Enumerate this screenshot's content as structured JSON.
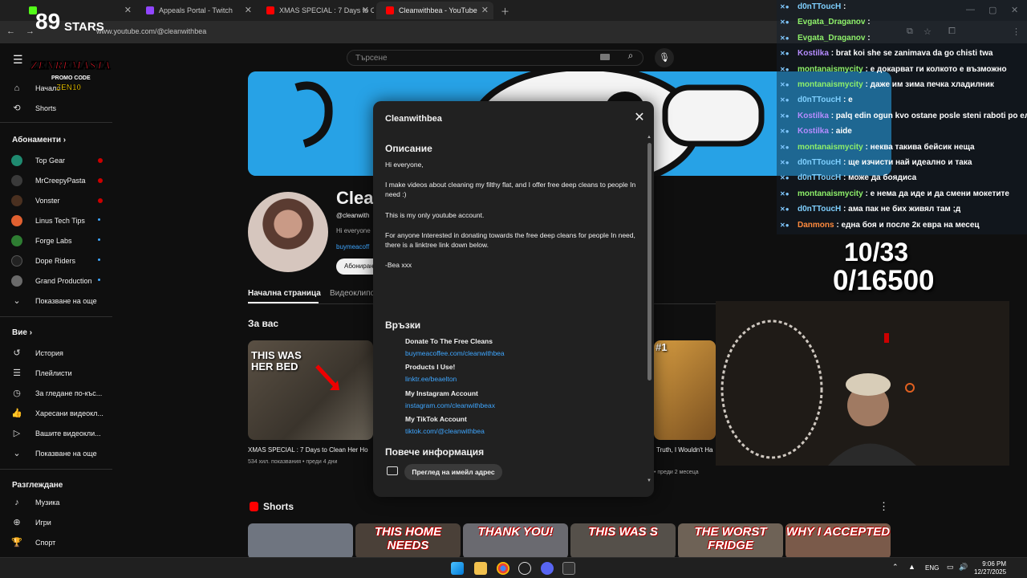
{
  "browser": {
    "tabs": [
      {
        "title": "",
        "favicon_color": "#53fc18"
      },
      {
        "title": "Appeals Portal - Twitch",
        "favicon_color": "#9146ff"
      },
      {
        "title": "XMAS SPECIAL : 7 Days to Clea",
        "favicon_color": "#ff0000"
      },
      {
        "title": "Cleanwithbea - YouTube",
        "favicon_color": "#ff0000"
      }
    ],
    "url": "www.youtube.com/@cleanwithbea"
  },
  "youtube": {
    "search_placeholder": "Търсене",
    "sidebar": {
      "home": "Начало",
      "shorts": "Shorts",
      "subscriptions_head": "Абонаменти",
      "subscriptions": [
        {
          "label": "Top Gear",
          "color": "#1f8a70",
          "dot": "#cc0000"
        },
        {
          "label": "MrCreepyPasta",
          "color": "#3a3a3a",
          "dot": "#cc0000"
        },
        {
          "label": "Vonster",
          "color": "#4a3020",
          "dot": "#cc0000"
        },
        {
          "label": "Linus Tech Tips",
          "color": "#e06030",
          "dot": "#3ea6ff"
        },
        {
          "label": "Forge Labs",
          "color": "#2e7d32",
          "dot": "#3ea6ff"
        },
        {
          "label": "Dope Riders",
          "color": "#222222",
          "dot": "#3ea6ff"
        },
        {
          "label": "Grand Production",
          "color": "#6a6a6a",
          "dot": "#3ea6ff"
        }
      ],
      "show_more_subs": "Показване на още",
      "you_head": "Вие",
      "you_items": [
        "История",
        "Плейлисти",
        "За гледане по-къс...",
        "Харесани видеокл...",
        "Вашите видеокли...",
        "Показване на още"
      ],
      "explore_head": "Разглеждане",
      "explore_items": [
        "Музика",
        "Игри",
        "Спорт"
      ]
    },
    "channel": {
      "name": "Clea",
      "handle": "@cleanwith",
      "desc": "Hi everyone",
      "link": "buymeacoff",
      "subscribe": "Абониране",
      "tab_home": "Начална страница",
      "tab_videos": "Видеоклипо",
      "for_you": "За вас"
    },
    "videos": [
      {
        "title": "XMAS SPECIAL : 7 Days to Clean Her Ho",
        "meta": "534 хил. показвания  •  преди 4 дни",
        "thumb_text": "THIS WAS\nHER BED"
      },
      {
        "title": "Truth, I Wouldn't Ha",
        "meta": "• преди 2 месеца",
        "thumb_text": "#1"
      }
    ],
    "shorts_head": "Shorts",
    "shorts": [
      "",
      "THIS HOME NEEDS",
      "THANK YOU!",
      "THIS WAS S",
      "THE WORST FRIDGE",
      "WHY I ACCEPTED"
    ]
  },
  "modal": {
    "title": "Cleanwithbea",
    "description_head": "Описание",
    "description": [
      "Hi everyone,",
      "I make videos about cleaning my filthy flat, and I offer free deep cleans to people In need :)",
      "This is my only youtube account.",
      "For anyone Interested in donating towards the free deep cleans for people In need, there is a linktree link down below.",
      "-Bea xxx"
    ],
    "links_head": "Връзки",
    "links": [
      {
        "name": "Donate To The Free Cleans",
        "url": "buymeacoffee.com/cleanwithbea"
      },
      {
        "name": "Products I Use!",
        "url": "linktr.ee/beaelton"
      },
      {
        "name": "My Instagram Account",
        "url": "instagram.com/cleanwithbeax"
      },
      {
        "name": "My TikTok Account",
        "url": "tiktok.com/@cleanwithbea"
      }
    ],
    "more_info_head": "Повече информация",
    "email_button": "Преглед на имейл адрес"
  },
  "overlay": {
    "chat": [
      {
        "user": "d0nTTouсH",
        "msg": ":",
        "color": "#7fd0ff"
      },
      {
        "user": "Evgata_Draganov",
        "msg": ":",
        "color": "#8ef06a"
      },
      {
        "user": "Evgata_Draganov",
        "msg": ":",
        "color": "#8ef06a"
      },
      {
        "user": "Kostilka",
        "msg": ": brat koi she se zanimava da go chisti twa",
        "color": "#b58cff"
      },
      {
        "user": "montanaismycity",
        "msg": ": е докарват ги колкото е възможно",
        "color": "#8ef06a"
      },
      {
        "user": "montanaismycity",
        "msg": ": даже им зима печка хладилник",
        "color": "#8ef06a"
      },
      {
        "user": "d0nTTouсH",
        "msg": ": е",
        "color": "#7fd0ff"
      },
      {
        "user": "Kostilka",
        "msg": ": palq edin ogun kvo ostane posle steni raboti po ел",
        "color": "#b58cff"
      },
      {
        "user": "Kostilka",
        "msg": ": aide",
        "color": "#b58cff"
      },
      {
        "user": "montanaismycity",
        "msg": ": неква такива бейсик неща",
        "color": "#8ef06a"
      },
      {
        "user": "d0nTTouсH",
        "msg": ": ще изчисти най идеално и така",
        "color": "#7fd0ff"
      },
      {
        "user": "d0nTTouсH",
        "msg": ": може да бoядиса",
        "color": "#7fd0ff"
      },
      {
        "user": "montanaismycity",
        "msg": ": е нема да иде и да смени мокетите",
        "color": "#8ef06a"
      },
      {
        "user": "d0nTTouсH",
        "msg": ": ама пак не бих живял там ;д",
        "color": "#7fd0ff"
      },
      {
        "user": "Danmons",
        "msg": ": една боя и после 2к евра на месец",
        "color": "#ff8a3d"
      }
    ],
    "counter_top": "10/33",
    "counter_bottom": "0/16500",
    "logo_top": "STARS",
    "logo_bottom": "ZENREMASTA",
    "logo_promo": "PROMO CODE",
    "logo_code": "ZEN10"
  },
  "taskbar": {
    "lang": "ENG",
    "time": "9:06 PM",
    "date": "12/27/2025"
  }
}
